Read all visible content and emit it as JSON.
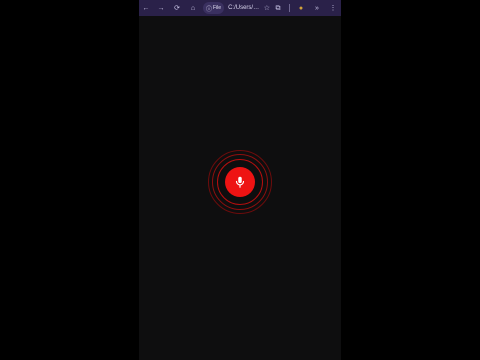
{
  "browser": {
    "toolbar": {
      "file_label": "File",
      "url_text": "C:/Users/…",
      "back_label": "←",
      "forward_label": "→",
      "reload_label": "⟳",
      "home_label": "⌂",
      "bookmark_label": "☆",
      "extension_label": "⧉",
      "profile_label": "●",
      "more_label": "⋮",
      "overflow_label": "»"
    }
  },
  "main": {
    "mic_button_icon": "microphone-icon",
    "accent_color": "#ee1313"
  }
}
